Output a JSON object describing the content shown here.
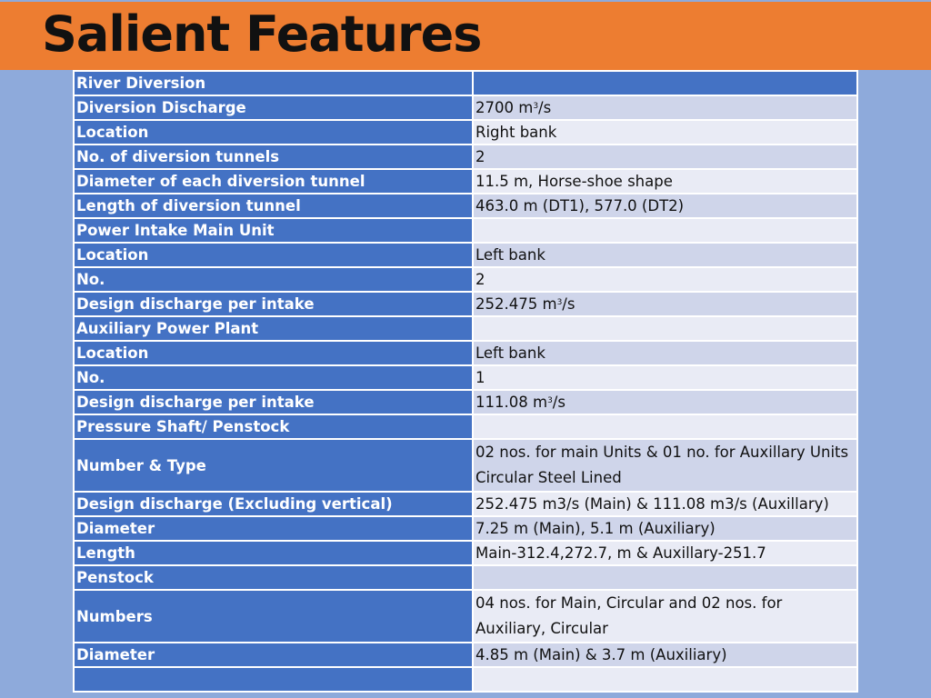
{
  "title": "Salient Features",
  "rows": [
    {
      "label": "River Diversion",
      "value": "",
      "kind": "header"
    },
    {
      "label": "Diversion Discharge",
      "value": "2700 m",
      "sup": "3",
      "suffix": "/s"
    },
    {
      "label": "Location",
      "value": "Right bank"
    },
    {
      "label": "No. of diversion tunnels",
      "value": "2"
    },
    {
      "label": "Diameter of each diversion tunnel",
      "value": "11.5 m, Horse-shoe shape"
    },
    {
      "label": "Length of diversion tunnel",
      "value": "463.0 m (DT1), 577.0 (DT2)"
    },
    {
      "label": "Power Intake Main Unit",
      "value": ""
    },
    {
      "label": "Location",
      "value": "Left bank"
    },
    {
      "label": "No.",
      "value": "2"
    },
    {
      "label": "Design discharge per intake",
      "value": "252.475 m",
      "sup": "3",
      "suffix": "/s"
    },
    {
      "label": "Auxiliary Power Plant",
      "value": ""
    },
    {
      "label": "Location",
      "value": "Left bank"
    },
    {
      "label": "No.",
      "value": "1"
    },
    {
      "label": "Design discharge per intake",
      "value": "111.08 m",
      "sup": "3",
      "suffix": "/s"
    },
    {
      "label": "Pressure Shaft/ Penstock",
      "value": ""
    },
    {
      "label": "Number & Type",
      "value": "02 nos. for main Units & 01 no. for Auxillary Units Circular Steel Lined",
      "kind": "tall"
    },
    {
      "label": "Design discharge (Excluding vertical)",
      "value": "252.475 m3/s (Main) & 111.08 m3/s (Auxillary)"
    },
    {
      "label": "Diameter",
      "value": "7.25 m (Main), 5.1 m (Auxiliary)"
    },
    {
      "label": "Length",
      "value": "Main-312.4,272.7, m & Auxillary-251.7"
    },
    {
      "label": "Penstock",
      "value": ""
    },
    {
      "label": "Numbers",
      "value": "04 nos. for Main, Circular and 02 nos. for Auxiliary, Circular",
      "kind": "tall"
    },
    {
      "label": "Diameter",
      "value": "4.85 m (Main) & 3.7 m (Auxiliary)"
    },
    {
      "label": "",
      "value": ""
    }
  ]
}
